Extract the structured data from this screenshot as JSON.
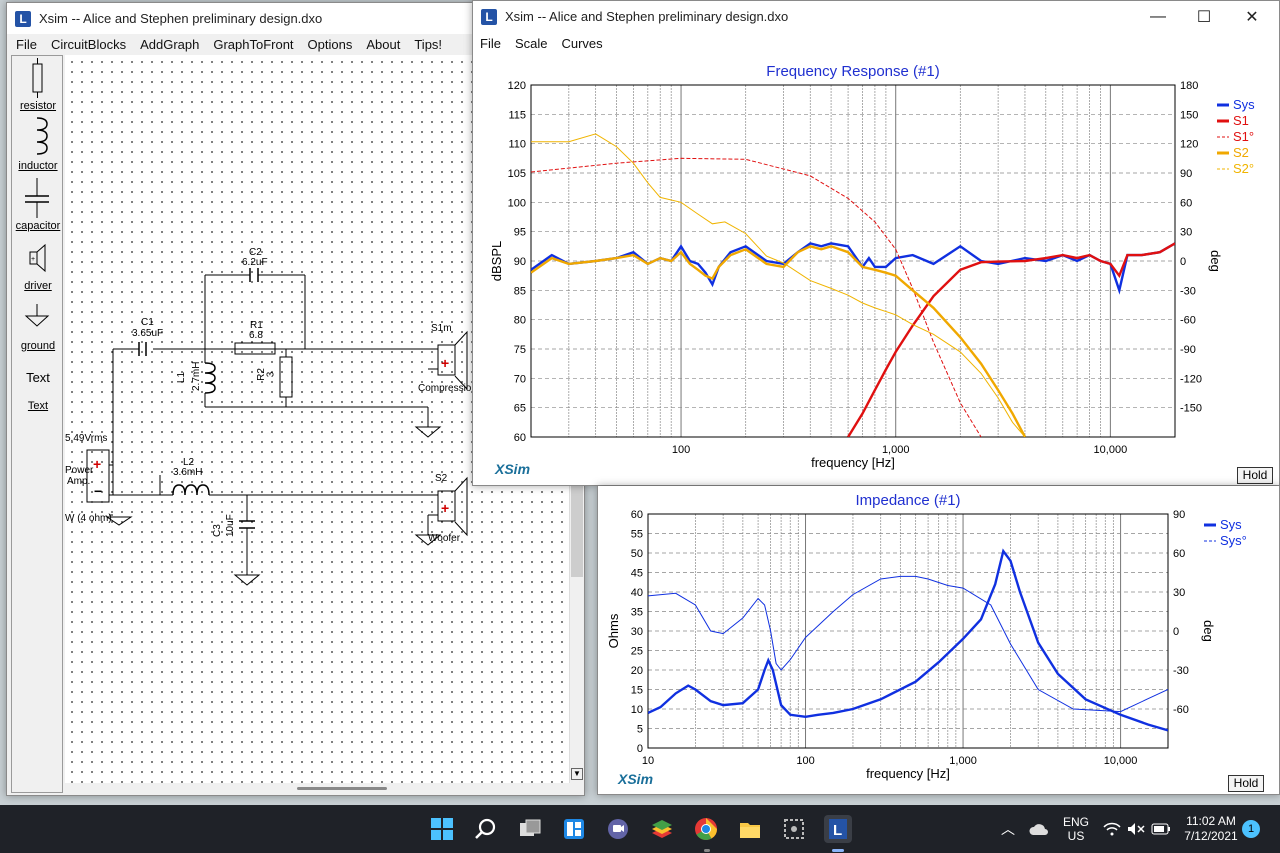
{
  "schematic_window": {
    "title": "Xsim -- Alice and Stephen preliminary design.dxo",
    "menu": [
      "File",
      "CircuitBlocks",
      "AddGraph",
      "GraphToFront",
      "Options",
      "About",
      "Tips!"
    ],
    "palette": [
      "resistor",
      "inductor",
      "capacitor",
      "driver",
      "ground",
      "Text",
      "Text"
    ],
    "components": {
      "c1_name": "C1",
      "c1_value": "3.65uF",
      "c2_name": "C2",
      "c2_value": "6.2uF",
      "r1_name": "R1",
      "r1_value": "6.8",
      "r2_name": "R2",
      "r2_value": "3",
      "l1_name": "L1",
      "l1_value": "2.7mH",
      "l2_name": "L2",
      "l2_value": "3.6mH",
      "c3_name": "C3",
      "c3_value": "10uF",
      "s1_name": "S1m",
      "s1_label": "Compression",
      "s2_name": "S2",
      "s2_label": "Woofer",
      "amp_voltage": "5.49Vrms",
      "amp_label1": "Power",
      "amp_label2": "Amp.",
      "amp_power": "W (4 ohm)"
    }
  },
  "freq_window": {
    "title": "Xsim -- Alice and Stephen preliminary design.dxo",
    "menu": [
      "File",
      "Scale",
      "Curves"
    ],
    "controls": [
      "minimize",
      "maximize",
      "close"
    ],
    "hold_label": "Hold",
    "logo": "XSim"
  },
  "imp_window": {
    "hold_label": "Hold",
    "logo": "XSim"
  },
  "chart_data": [
    {
      "type": "line",
      "title": "Frequency Response (#1)",
      "xlabel": "frequency [Hz]",
      "ylabel": "dBSPL",
      "y2label": "deg",
      "xscale": "log",
      "xlim": [
        20,
        20000
      ],
      "ylim": [
        60,
        120
      ],
      "y2lim": [
        -180,
        180
      ],
      "x_ticks": [
        "100",
        "1,000",
        "10,000"
      ],
      "y_ticks": [
        60,
        65,
        70,
        75,
        80,
        85,
        90,
        95,
        100,
        105,
        110,
        115,
        120
      ],
      "y2_ticks": [
        -150,
        -120,
        -90,
        -60,
        -30,
        0,
        30,
        60,
        90,
        120,
        150,
        180
      ],
      "legend": "top-right",
      "grid": true,
      "series": [
        {
          "name": "Sys",
          "color": "#1030e0",
          "axis": "left",
          "style": "solid-thick",
          "x": [
            20,
            25,
            30,
            40,
            50,
            60,
            70,
            80,
            90,
            100,
            110,
            120,
            130,
            140,
            150,
            170,
            200,
            250,
            300,
            350,
            400,
            450,
            500,
            600,
            700,
            750,
            800,
            900,
            1000,
            1200,
            1500,
            2000,
            2500,
            3000,
            4000,
            5000,
            6000,
            7000,
            8000,
            9000,
            10000,
            11000,
            12000,
            14000,
            17000,
            20000
          ],
          "y": [
            88.5,
            91,
            89.5,
            90,
            90.5,
            91.5,
            89.5,
            90.5,
            90,
            92.5,
            90,
            89.5,
            88,
            86,
            89,
            91.5,
            92.5,
            90,
            89.5,
            91.5,
            93,
            92.5,
            93,
            92.5,
            89,
            90.5,
            89,
            89,
            90.5,
            91,
            89.5,
            92.5,
            90,
            89.5,
            90.5,
            90,
            91,
            90,
            91,
            90,
            89.5,
            85,
            91,
            91,
            91.5,
            93
          ]
        },
        {
          "name": "S1",
          "color": "#e01010",
          "axis": "left",
          "style": "solid-thick",
          "x": [
            600,
            700,
            800,
            900,
            1000,
            1200,
            1500,
            2000,
            2500,
            3000,
            4000,
            5000,
            6000,
            7000,
            8000,
            9000,
            10000,
            11000,
            12000,
            14000,
            17000,
            20000
          ],
          "y": [
            60,
            64,
            68,
            71.5,
            74.5,
            79,
            84,
            88.5,
            89.8,
            89.9,
            90,
            90.5,
            91,
            90.5,
            91,
            90,
            89.5,
            87.5,
            91,
            91,
            91.5,
            93
          ]
        },
        {
          "name": "S1°",
          "color": "#e01010",
          "axis": "right",
          "style": "dashed-thin",
          "x": [
            20,
            50,
            100,
            200,
            400,
            600,
            800,
            1000,
            1200,
            1500,
            2000,
            2500
          ],
          "y": [
            91,
            100,
            105,
            104,
            87,
            64,
            40,
            12,
            -28,
            -83,
            -145,
            -180
          ]
        },
        {
          "name": "S2",
          "color": "#f0a800",
          "axis": "left",
          "style": "solid-thick",
          "x": [
            20,
            25,
            30,
            40,
            50,
            60,
            70,
            80,
            90,
            100,
            110,
            120,
            130,
            140,
            150,
            170,
            200,
            250,
            300,
            350,
            400,
            450,
            500,
            600,
            700,
            800,
            900,
            1000,
            1200,
            1500,
            2000,
            2500,
            3000,
            3500,
            4000
          ],
          "y": [
            88,
            90.5,
            89.5,
            90,
            90.5,
            91,
            89.5,
            90.5,
            90,
            91.5,
            89.5,
            88.5,
            87.5,
            87,
            89,
            91,
            92,
            89.5,
            89,
            91.5,
            92.5,
            92,
            92.5,
            91.5,
            89,
            88.5,
            88,
            87.5,
            85,
            82,
            77,
            72.5,
            68,
            64,
            60
          ]
        },
        {
          "name": "S2°",
          "color": "#f0b400",
          "axis": "right",
          "style": "solid-thin",
          "x": [
            20,
            30,
            40,
            50,
            60,
            70,
            80,
            100,
            120,
            140,
            160,
            200,
            250,
            300,
            400,
            500,
            600,
            700,
            800,
            1000,
            1200,
            1500,
            2000,
            2500,
            3000,
            3500,
            4000
          ],
          "y": [
            122,
            122,
            130,
            117,
            100,
            80,
            65,
            60,
            48,
            38,
            40,
            28,
            5,
            -2,
            -20,
            -28,
            -35,
            -43,
            -48,
            -55,
            -65,
            -75,
            -93,
            -115,
            -140,
            -165,
            -180
          ]
        }
      ]
    },
    {
      "type": "line",
      "title": "Impedance (#1)",
      "xlabel": "frequency [Hz]",
      "ylabel": "Ohms",
      "y2label": "deg",
      "xscale": "log",
      "xlim": [
        10,
        20000
      ],
      "ylim": [
        0,
        60
      ],
      "y2lim": [
        -90,
        90
      ],
      "x_ticks": [
        "10",
        "100",
        "1,000",
        "10,000"
      ],
      "y_ticks": [
        0,
        5,
        10,
        15,
        20,
        25,
        30,
        35,
        40,
        45,
        50,
        55,
        60
      ],
      "y2_ticks": [
        -60,
        -30,
        0,
        30,
        60,
        90
      ],
      "legend": "top-right",
      "grid": true,
      "series": [
        {
          "name": "Sys",
          "color": "#1030e0",
          "axis": "left",
          "style": "solid-thick",
          "x": [
            10,
            12,
            15,
            18,
            20,
            25,
            30,
            40,
            50,
            55,
            58,
            62,
            70,
            80,
            100,
            120,
            150,
            200,
            300,
            500,
            700,
            1000,
            1300,
            1600,
            1800,
            2000,
            2300,
            3000,
            4000,
            6000,
            10000,
            15000,
            20000
          ],
          "y": [
            9,
            10.5,
            14,
            16,
            15,
            12,
            11,
            11.5,
            15,
            20,
            22.5,
            20,
            11,
            8.5,
            8,
            8.5,
            9,
            10,
            12.5,
            17,
            22,
            28,
            33,
            42,
            50.5,
            48,
            40,
            27,
            19,
            12.5,
            8.5,
            6,
            4.5
          ]
        },
        {
          "name": "Sys°",
          "color": "#1030e0",
          "axis": "right",
          "style": "solid-thin",
          "x": [
            10,
            15,
            20,
            25,
            30,
            40,
            50,
            55,
            60,
            65,
            70,
            80,
            100,
            150,
            200,
            300,
            400,
            500,
            600,
            800,
            1000,
            1500,
            2000,
            3000,
            5000,
            10000,
            15000,
            20000
          ],
          "y": [
            27,
            29,
            20,
            0,
            -2,
            10,
            25,
            20,
            0,
            -25,
            -30,
            -22,
            -5,
            15,
            28,
            40,
            42,
            42,
            40,
            35,
            33,
            20,
            -10,
            -45,
            -60,
            -62,
            -52,
            -45
          ]
        }
      ]
    }
  ],
  "taskbar": {
    "icons": [
      "windows-start-icon",
      "search-icon",
      "task-view-icon",
      "widgets-icon",
      "teams-chat-icon",
      "stack-app-icon",
      "chrome-icon",
      "file-explorer-icon",
      "snipping-icon",
      "xsim-icon"
    ],
    "lang1": "ENG",
    "lang2": "US",
    "time": "11:02 AM",
    "date": "7/12/2021",
    "notification_count": "1"
  }
}
